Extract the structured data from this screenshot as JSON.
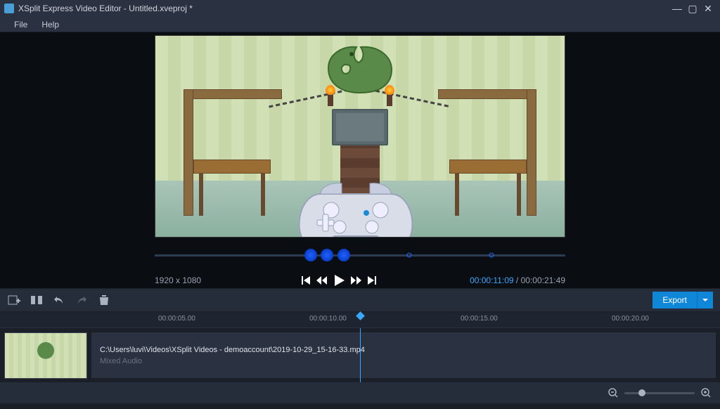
{
  "window": {
    "title": "XSplit Express Video Editor - Untitled.xveproj *"
  },
  "menu": {
    "file": "File",
    "help": "Help"
  },
  "preview": {
    "resolution": "1920 x 1080",
    "current_time": "00:00:11:09",
    "separator": " / ",
    "total_time": "00:00:21:49"
  },
  "toolbar": {
    "export_label": "Export"
  },
  "ruler": {
    "t1": "00:00:05.00",
    "t2": "00:00:10.00",
    "t3": "00:00:15.00",
    "t4": "00:00:20.00"
  },
  "clip": {
    "path": "C:\\Users\\luvi\\Videos\\XSplit Videos - demoaccount\\2019-10-29_15-16-33.mp4",
    "audio": "Mixed Audio"
  }
}
